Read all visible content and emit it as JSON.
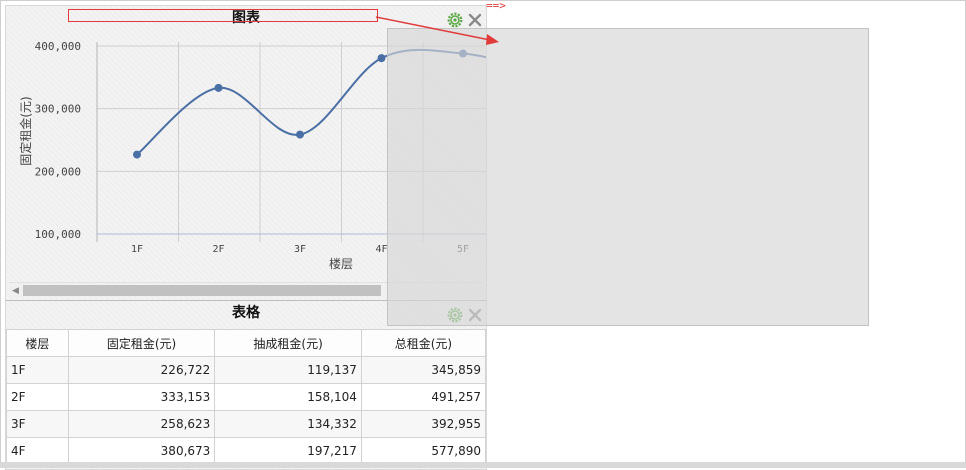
{
  "chart_panel": {
    "title": "图表",
    "icons": {
      "settings": "gear-icon",
      "close": "close-icon"
    }
  },
  "chart_data": {
    "type": "line",
    "categories": [
      "1F",
      "2F",
      "3F",
      "4F",
      "5F"
    ],
    "series": [
      {
        "values": [
          226722,
          333153,
          258623,
          380673,
          388000
        ]
      }
    ],
    "y_tick_labels": [
      "100,000",
      "200,000",
      "300,000",
      "400,000"
    ],
    "ylim": [
      100000,
      400000
    ],
    "xlabel": "楼层",
    "ylabel": "固定租金(元)",
    "grid": true,
    "line_color": "#4a6fa5"
  },
  "table_panel": {
    "title": "表格",
    "icons": {
      "settings": "gear-icon",
      "close": "close-icon"
    },
    "columns": [
      "楼层",
      "固定租金(元)",
      "抽成租金(元)",
      "总租金(元)"
    ],
    "rows": [
      [
        "1F",
        "226,722",
        "119,137",
        "345,859"
      ],
      [
        "2F",
        "333,153",
        "158,104",
        "491,257"
      ],
      [
        "3F",
        "258,623",
        "134,332",
        "392,955"
      ],
      [
        "4F",
        "380,673",
        "197,217",
        "577,890"
      ]
    ]
  },
  "drag_hint": "==>",
  "colors": {
    "accent_red": "#e03a3a",
    "gear_green": "#5aa845"
  }
}
